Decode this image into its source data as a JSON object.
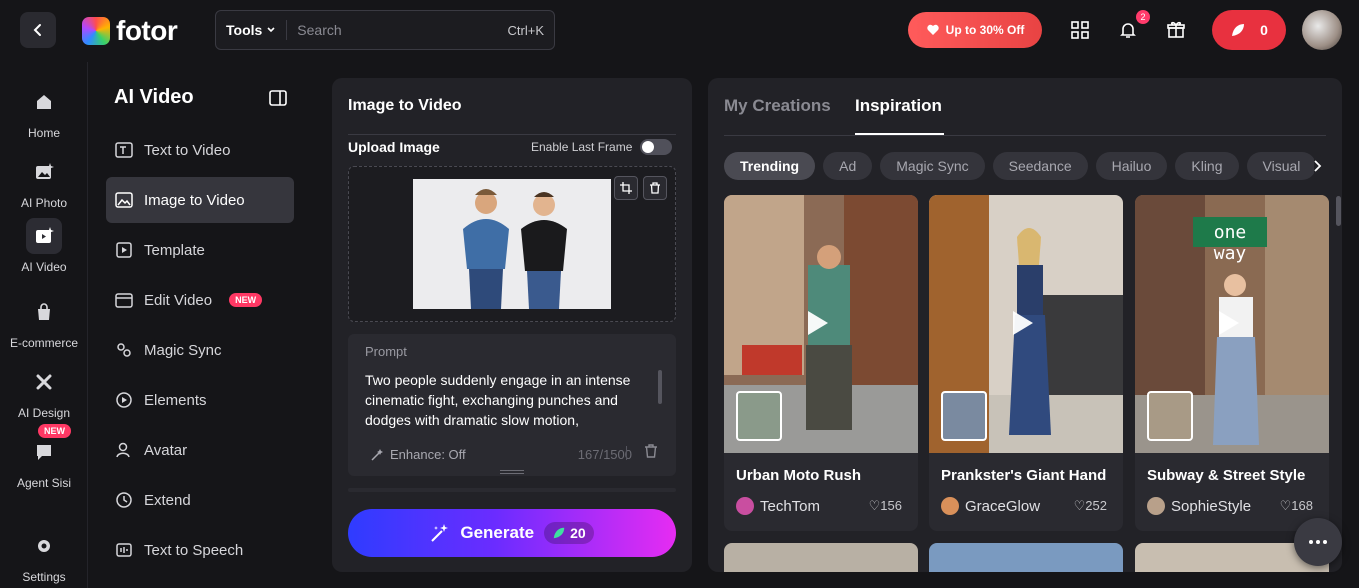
{
  "header": {
    "logo_text": "fotor",
    "search_tools_label": "Tools",
    "search_placeholder": "Search",
    "search_shortcut": "Ctrl+K",
    "promo_label": "Up to 30% Off",
    "notifications_count": "2",
    "credits": "0"
  },
  "rail": {
    "items": [
      {
        "label": "Home",
        "icon": "home-icon"
      },
      {
        "label": "AI Photo",
        "icon": "ai-photo-icon"
      },
      {
        "label": "AI Video",
        "icon": "ai-video-icon"
      },
      {
        "label": "E-commerce",
        "icon": "shopping-bag-icon"
      },
      {
        "label": "AI Design",
        "icon": "ai-design-icon"
      },
      {
        "label": "Agent Sisi",
        "icon": "chat-heart-icon",
        "badge": "NEW"
      },
      {
        "label": "Settings",
        "icon": "gear-icon"
      }
    ]
  },
  "sidenav": {
    "title": "AI Video",
    "items": [
      {
        "label": "Text to Video"
      },
      {
        "label": "Image to Video"
      },
      {
        "label": "Template"
      },
      {
        "label": "Edit Video",
        "badge": "NEW"
      },
      {
        "label": "Magic Sync"
      },
      {
        "label": "Elements"
      },
      {
        "label": "Avatar"
      },
      {
        "label": "Extend"
      },
      {
        "label": "Text to Speech"
      }
    ]
  },
  "panel": {
    "title": "Image to Video",
    "upload_label": "Upload Image",
    "last_frame_label": "Enable Last Frame",
    "prompt_label": "Prompt",
    "prompt_text": "Two people suddenly engage in an intense cinematic fight, exchanging punches and dodges with dramatic slow motion,",
    "enhance_label": "Enhance: Off",
    "char_count": "167/1500",
    "generate_label": "Generate",
    "generate_cost": "20"
  },
  "gallery": {
    "tabs": [
      "My Creations",
      "Inspiration"
    ],
    "active_tab": "Inspiration",
    "chips": [
      "Trending",
      "Ad",
      "Magic Sync",
      "Seedance",
      "Hailuo",
      "Kling",
      "Visual"
    ],
    "cards": [
      {
        "title": "Urban Moto Rush",
        "author": "TechTom",
        "likes": "156"
      },
      {
        "title": "Prankster's Giant Hand",
        "author": "GraceGlow",
        "likes": "252"
      },
      {
        "title": "Subway & Street Style",
        "author": "SophieStyle",
        "likes": "168"
      }
    ],
    "sign_text": "one way"
  },
  "colors": {
    "accent_red": "#e8313f",
    "generate_start": "#2f3cff",
    "generate_end": "#e62cf2",
    "badge_pink": "#ff3864"
  }
}
